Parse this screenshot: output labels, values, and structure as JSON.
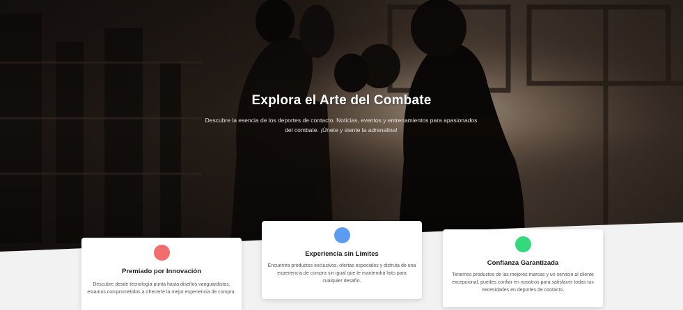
{
  "hero": {
    "title": "Explora el Arte del Combate",
    "subtitle": "Descubre la esencia de los deportes de contacto. Noticias, eventos y entrenamientos para apasionados del combate. ¡Únete y siente la adrenalina!"
  },
  "features": [
    {
      "title": "Premiado por Innovación",
      "description": "Descubre desde tecnología punta hasta diseños vanguardistas, estamos comprometidos a ofrecerte la mejor experiencia de compra.",
      "icon": "red-circle-icon",
      "color": "#f36d6d"
    },
    {
      "title": "Experiencia sin Limites",
      "description": "Encuentra productos exclusivos, ofertas especiales y disfruta de una experiencia de compra sin igual que te mantendrá listo para cualquier desafío.",
      "icon": "blue-circle-icon",
      "color": "#5b9cf2"
    },
    {
      "title": "Confianza Garantizada",
      "description": "Tenemos productos de las mejores marcas y un servicio al cliente excepcional, puedes confiar en nosotros para satisfacer todas tus necesidades en deportes de contacto.",
      "icon": "green-circle-icon",
      "color": "#35d97b"
    }
  ]
}
